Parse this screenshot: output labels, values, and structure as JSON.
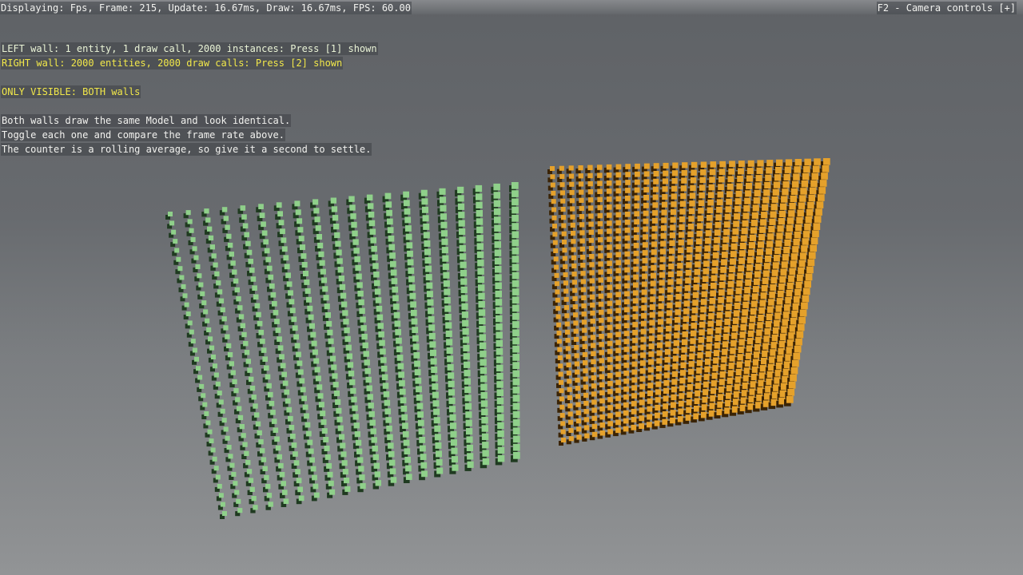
{
  "hud": {
    "stats_line": "Displaying: Fps, Frame: 215, Update: 16.67ms, Draw: 16.67ms, FPS: 60.00",
    "camera_controls": "F2 - Camera controls [+]",
    "left_wall_line": "LEFT wall: 1 entity, 1 draw call, 2000 instances: Press [1] shown",
    "right_wall_line": "RIGHT wall: 2000 entities, 2000 draw calls: Press [2] shown",
    "only_visible_line": "ONLY VISIBLE: BOTH walls",
    "info_lines": [
      "Both walls draw the same Model and look identical.",
      "Toggle each one and compare the frame rate above.",
      "The counter is a rolling average, so give it a second to settle."
    ]
  },
  "scene": {
    "walls": [
      {
        "name": "left-wall",
        "entities": 1,
        "draw_calls": 1,
        "instances": 2000,
        "cube_color": "#8fd08a",
        "shadow_color": "#1f3a20"
      },
      {
        "name": "right-wall",
        "entities": 2000,
        "draw_calls": 2000,
        "cube_color": "#e5a12b",
        "shadow_color": "#3a2305"
      }
    ]
  }
}
